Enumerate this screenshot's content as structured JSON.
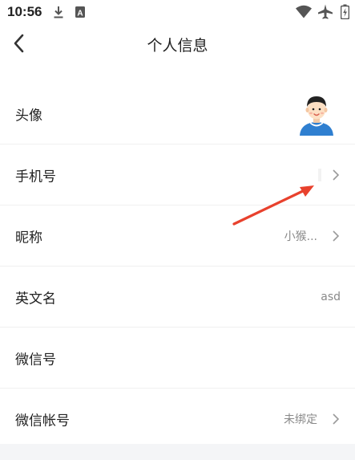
{
  "status_bar": {
    "time": "10:56",
    "left_icons": [
      "download-icon",
      "a-notification-icon"
    ],
    "right_icons": [
      "wifi-icon",
      "airplane-icon",
      "battery-icon"
    ]
  },
  "header": {
    "back_icon": "chevron-left-icon",
    "title": "个人信息"
  },
  "profile": {
    "rows": [
      {
        "label": "头像",
        "value": "",
        "trailing": "avatar"
      },
      {
        "label": "手机号",
        "value": "",
        "trailing": "chevron"
      },
      {
        "label": "昵称",
        "value": "小猴...",
        "trailing": "chevron"
      },
      {
        "label": "英文名",
        "value": "asd",
        "trailing": "none"
      },
      {
        "label": "微信号",
        "value": "",
        "trailing": "none"
      },
      {
        "label": "微信帐号",
        "value": "未绑定",
        "trailing": "chevron"
      }
    ]
  },
  "annotation": {
    "arrow_color": "#e8412d"
  },
  "colors": {
    "background": "#f4f5f7",
    "card": "#ffffff",
    "text": "#222222",
    "secondary_text": "#8a8a8a",
    "avatar_shirt": "#2f7fd0"
  }
}
